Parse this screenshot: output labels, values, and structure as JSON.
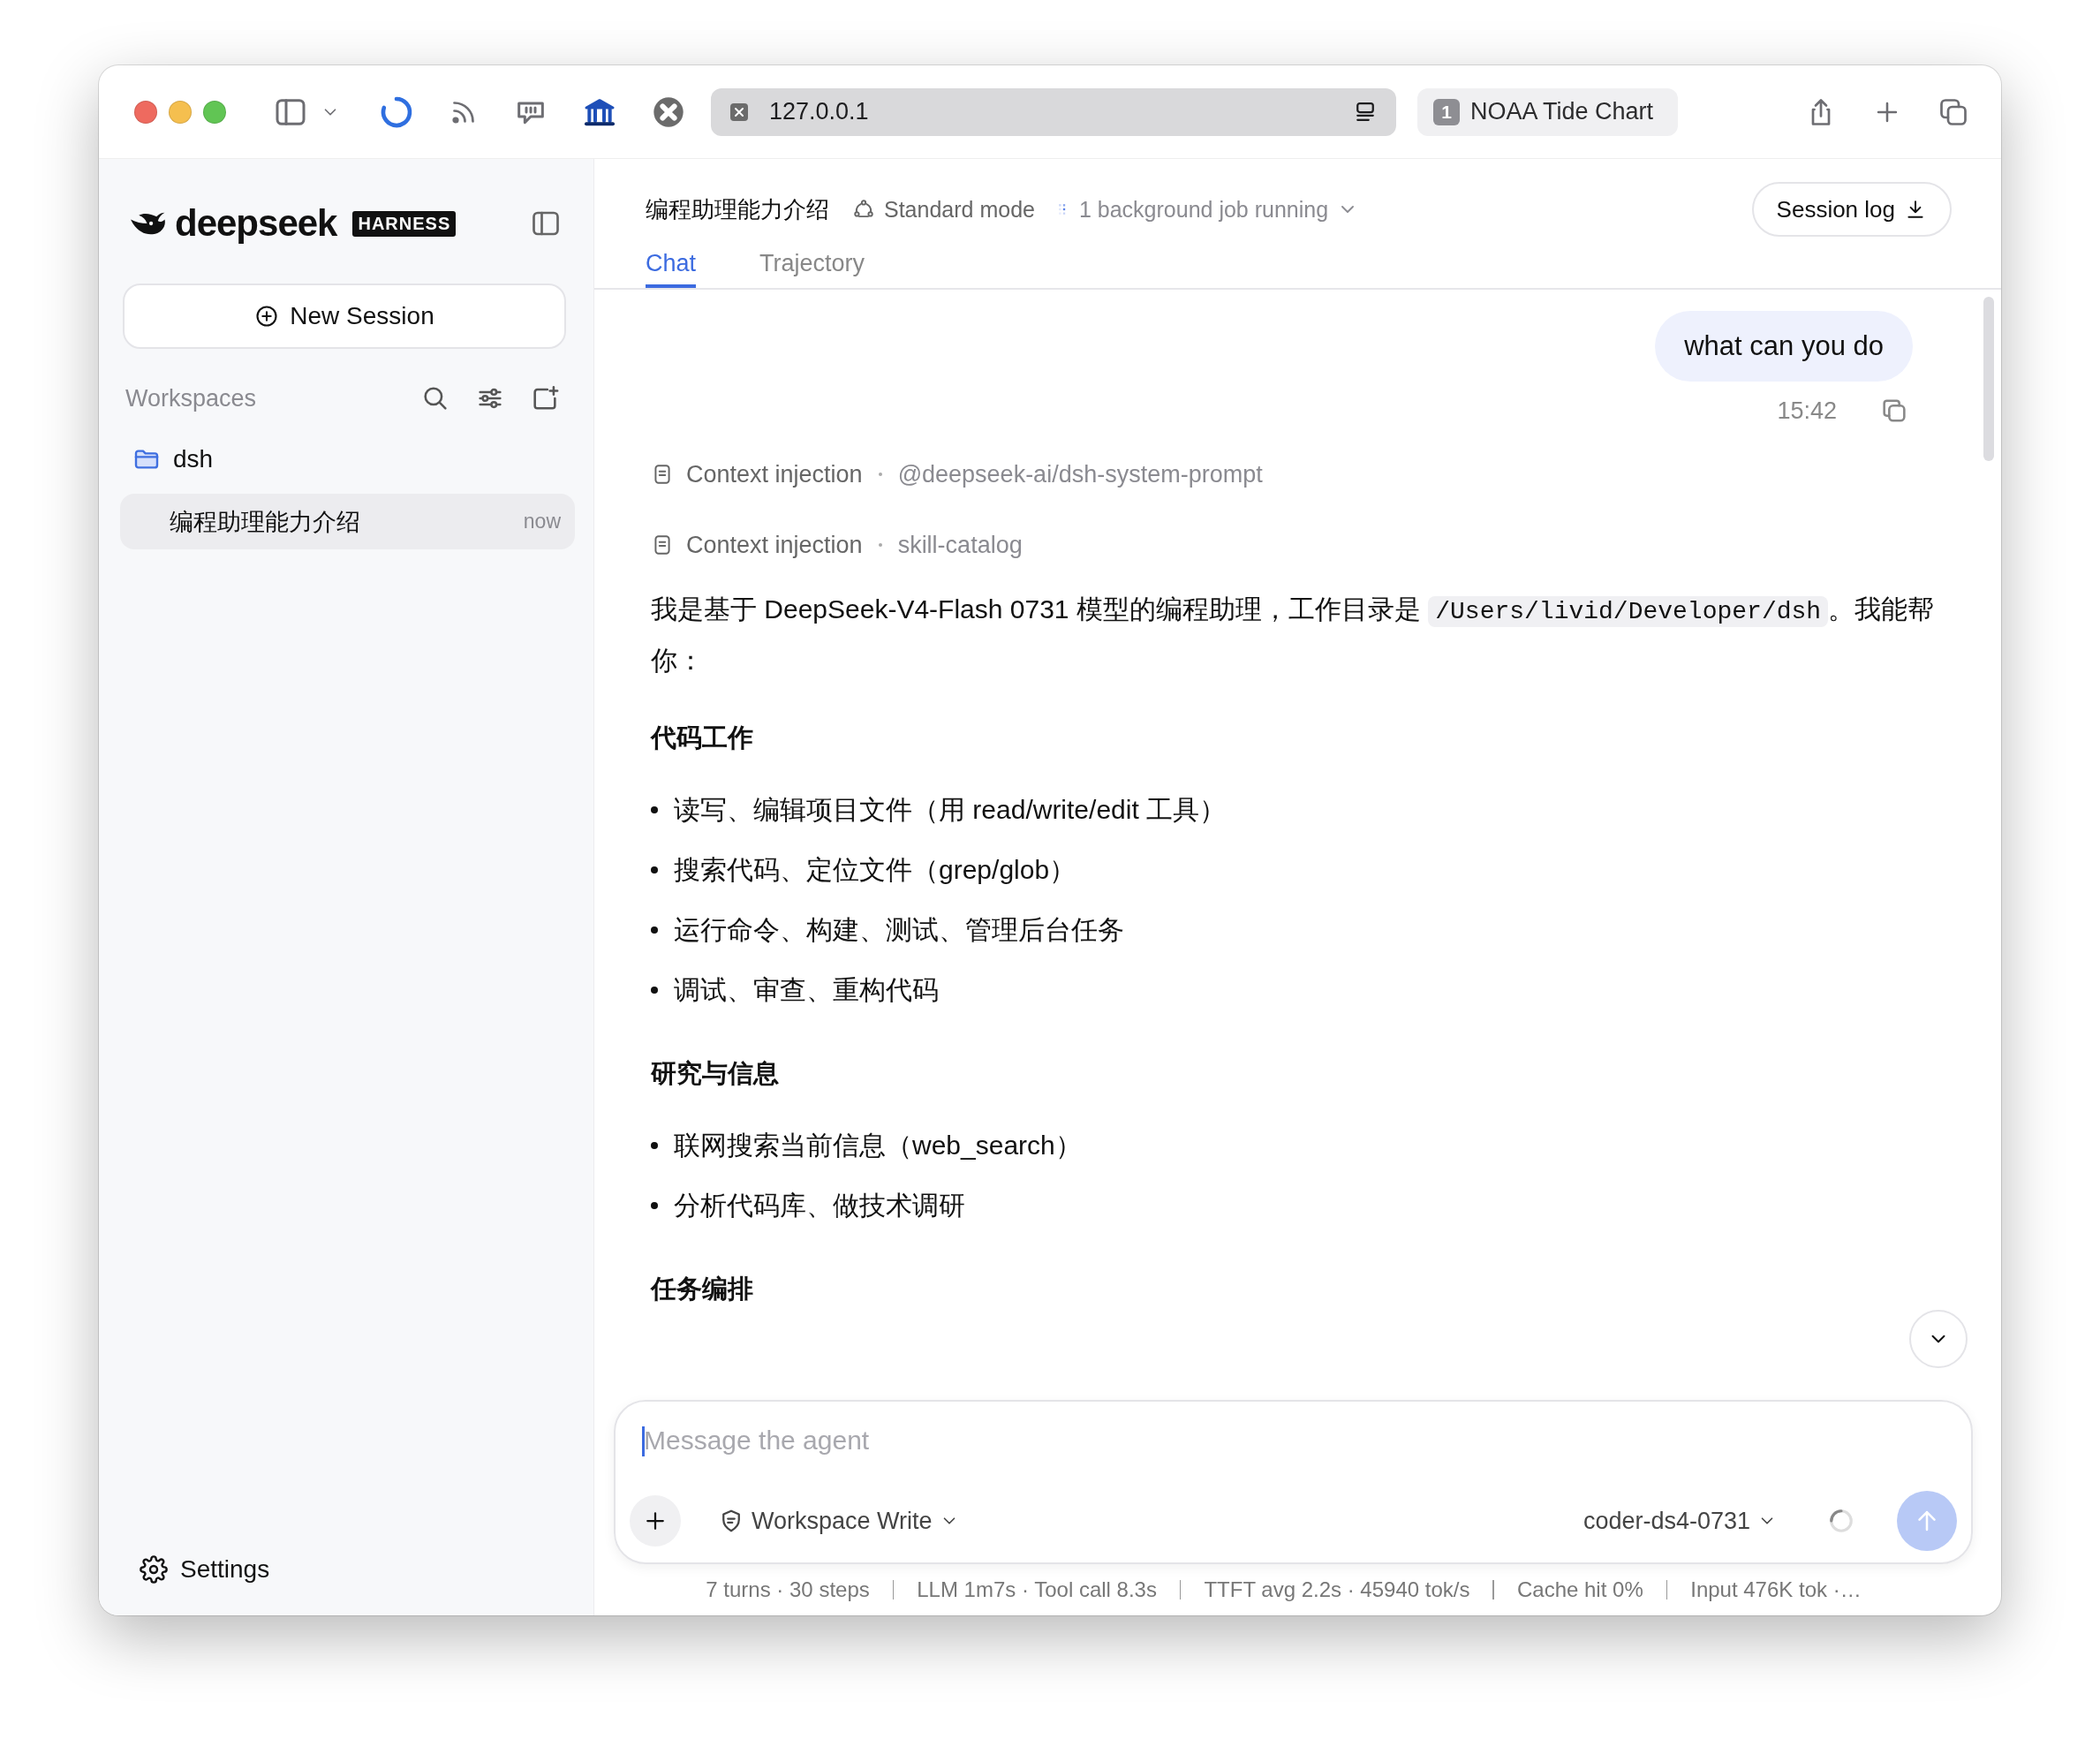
{
  "browser": {
    "address": "127.0.0.1",
    "tab": {
      "count": "1",
      "title": "NOAA Tide Chart"
    }
  },
  "sidebar": {
    "brand": "deepseek",
    "badge": "HARNESS",
    "new_session": "New Session",
    "section": "Workspaces",
    "workspaces": [
      {
        "name": "dsh",
        "sessions": [
          {
            "title": "编程助理能力介绍",
            "time": "now",
            "selected": true
          }
        ]
      }
    ],
    "settings": "Settings"
  },
  "header": {
    "title": "编程助理能力介绍",
    "mode": "Standard mode",
    "jobs": "1 background job running",
    "session_log": "Session log",
    "tabs": [
      {
        "label": "Chat",
        "selected": true
      },
      {
        "label": "Trajectory",
        "selected": false
      }
    ]
  },
  "messages": [
    {
      "kind": "user",
      "text": "what can you do",
      "time": "15:42"
    },
    {
      "kind": "context",
      "label": "Context injection",
      "source": "@deepseek-ai/dsh-system-prompt"
    },
    {
      "kind": "context",
      "label": "Context injection",
      "source": "skill-catalog"
    },
    {
      "kind": "paragraph",
      "parts": [
        {
          "text": "我是基于 DeepSeek-V4-Flash 0731 模型的编程助理，工作目录是 "
        },
        {
          "code": "/Users/livid/Developer/dsh"
        },
        {
          "text": "。我能帮你："
        }
      ]
    },
    {
      "kind": "heading",
      "text": "代码工作"
    },
    {
      "kind": "list",
      "items": [
        "读写、编辑项目文件（用 read/write/edit 工具）",
        "搜索代码、定位文件（grep/glob）",
        "运行命令、构建、测试、管理后台任务",
        "调试、审查、重构代码"
      ]
    },
    {
      "kind": "heading",
      "text": "研究与信息"
    },
    {
      "kind": "list",
      "items": [
        "联网搜索当前信息（web_search）",
        "分析代码库、做技术调研"
      ]
    },
    {
      "kind": "heading",
      "text": "任务编排"
    }
  ],
  "composer": {
    "placeholder": "Message the agent",
    "permission": "Workspace Write",
    "model": "coder-ds4-0731"
  },
  "stats": [
    "7 turns · 30 steps",
    "LLM 1m7s · Tool call 8.3s",
    "TTFT avg 2.2s · 45940 tok/s",
    "Cache hit 0%",
    "Input 476K tok ·…"
  ]
}
